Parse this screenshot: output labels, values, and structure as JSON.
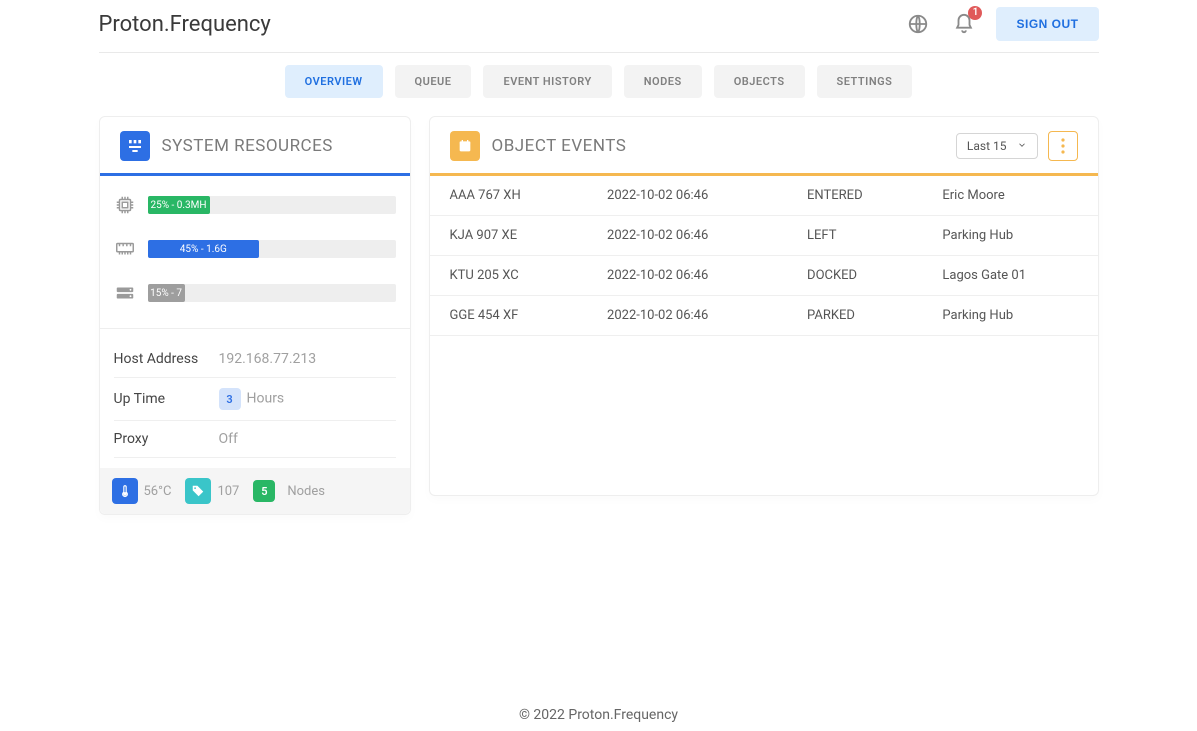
{
  "header": {
    "brand": "Proton.Frequency",
    "signout_label": "SIGN OUT",
    "notif_count": "1"
  },
  "tabs": [
    {
      "label": "OVERVIEW",
      "active": true
    },
    {
      "label": "QUEUE",
      "active": false
    },
    {
      "label": "EVENT HISTORY",
      "active": false
    },
    {
      "label": "NODES",
      "active": false
    },
    {
      "label": "OBJECTS",
      "active": false
    },
    {
      "label": "SETTINGS",
      "active": false
    }
  ],
  "resources": {
    "title": "SYSTEM RESOURCES",
    "meters": [
      {
        "icon": "cpu",
        "label": "25% - 0.3MH",
        "pct": 25,
        "color": "green"
      },
      {
        "icon": "memory",
        "label": "45% - 1.6G",
        "pct": 45,
        "color": "blue"
      },
      {
        "icon": "disk",
        "label": "15% - 7",
        "pct": 15,
        "color": "grey"
      }
    ],
    "details": {
      "host_label": "Host Address",
      "host_value": "192.168.77.213",
      "uptime_label": "Up Time",
      "uptime_badge": "3",
      "uptime_text": "Hours",
      "proxy_label": "Proxy",
      "proxy_value": "Off"
    },
    "footer": {
      "temp_value": "56°C",
      "tags_value": "107",
      "nodes_badge": "5",
      "nodes_label": "Nodes"
    }
  },
  "events": {
    "title": "OBJECT EVENTS",
    "filter_selected": "Last 15",
    "rows": [
      {
        "obj": "AAA 767 XH",
        "time": "2022-10-02 06:46",
        "status": "ENTERED",
        "loc": "Eric Moore"
      },
      {
        "obj": "KJA 907 XE",
        "time": "2022-10-02 06:46",
        "status": "LEFT",
        "loc": "Parking Hub"
      },
      {
        "obj": "KTU 205 XC",
        "time": "2022-10-02 06:46",
        "status": "DOCKED",
        "loc": "Lagos Gate 01"
      },
      {
        "obj": "GGE 454 XF",
        "time": "2022-10-02 06:46",
        "status": "PARKED",
        "loc": "Parking Hub"
      }
    ]
  },
  "footer": {
    "text": "© 2022 Proton.Frequency"
  }
}
